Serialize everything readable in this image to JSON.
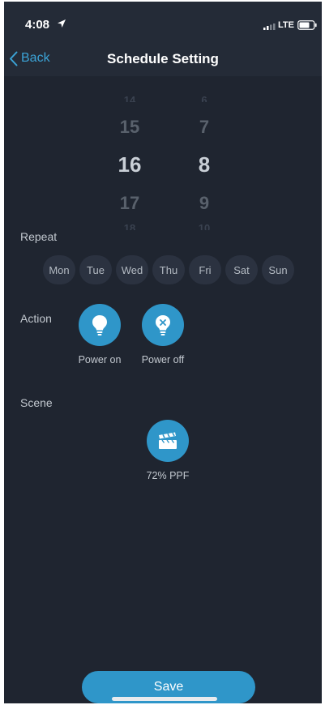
{
  "status_bar": {
    "time": "4:08",
    "network": "LTE"
  },
  "nav": {
    "back_label": "Back",
    "title": "Schedule Setting"
  },
  "time_picker": {
    "hours": [
      "14",
      "15",
      "16",
      "17",
      "18"
    ],
    "minutes": [
      "6",
      "7",
      "8",
      "9",
      "10"
    ],
    "selected_hour": "16",
    "selected_minute": "8"
  },
  "repeat": {
    "label": "Repeat",
    "days": [
      "Mon",
      "Tue",
      "Wed",
      "Thu",
      "Fri",
      "Sat",
      "Sun"
    ]
  },
  "action": {
    "label": "Action",
    "options": [
      {
        "label": "Power on",
        "icon": "lightbulb-icon"
      },
      {
        "label": "Power off",
        "icon": "lightbulb-off-icon"
      }
    ]
  },
  "scene": {
    "label": "Scene",
    "item": {
      "label": "72% PPF",
      "icon": "clapperboard-icon"
    }
  },
  "save_label": "Save",
  "colors": {
    "background": "#1f2530",
    "accent": "#2f96c9",
    "link": "#3ba3d6"
  }
}
